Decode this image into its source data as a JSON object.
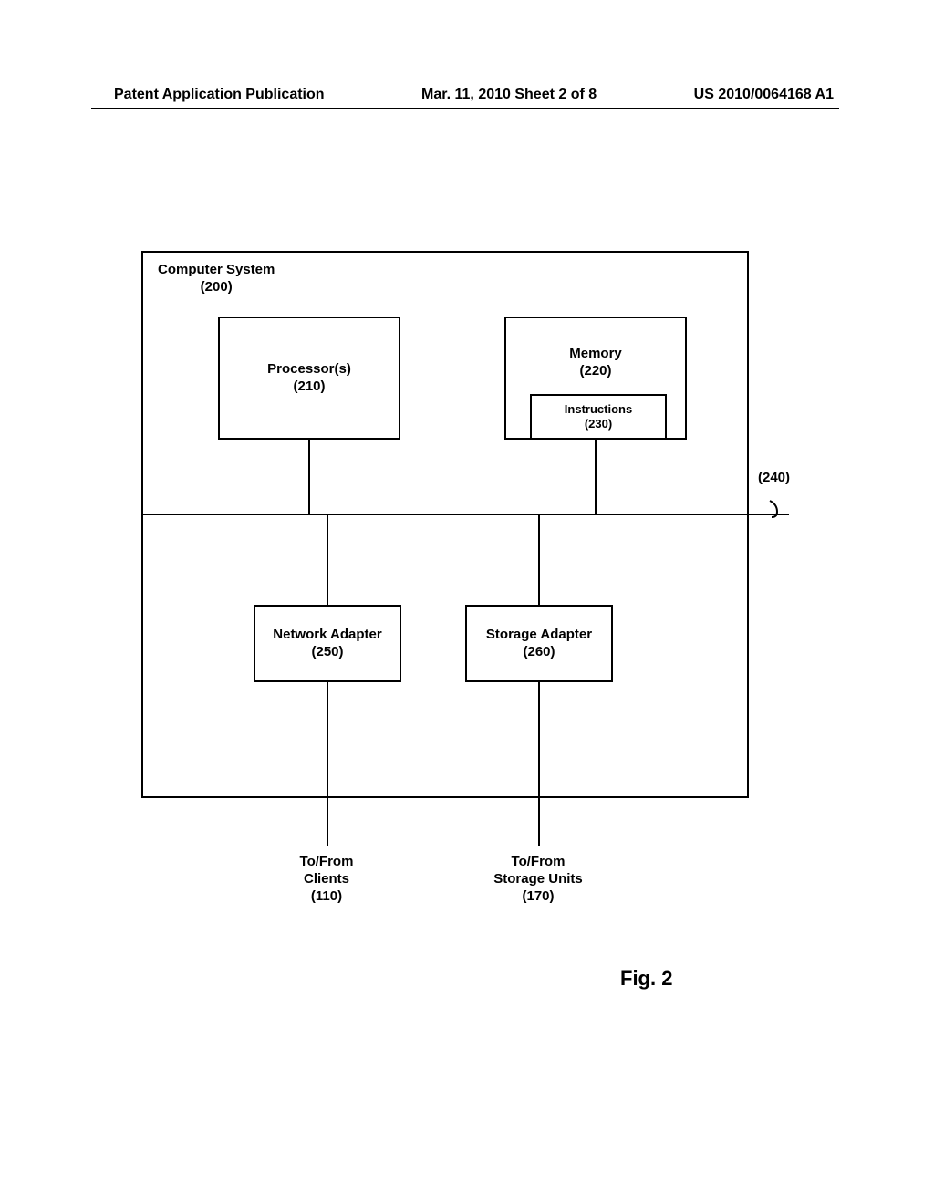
{
  "header": {
    "left": "Patent Application Publication",
    "middle": "Mar. 11, 2010  Sheet 2 of 8",
    "right": "US 2010/0064168 A1"
  },
  "system": {
    "label_line1": "Computer System",
    "label_line2": "(200)"
  },
  "processor": {
    "line1": "Processor(s)",
    "line2": "(210)"
  },
  "memory": {
    "line1": "Memory",
    "line2": "(220)"
  },
  "instructions": {
    "line1": "Instructions",
    "line2": "(230)"
  },
  "bus": {
    "label": "(240)"
  },
  "net_adapter": {
    "line1": "Network Adapter",
    "line2": "(250)"
  },
  "storage_adapter": {
    "line1": "Storage Adapter",
    "line2": "(260)"
  },
  "clients": {
    "line1": "To/From",
    "line2": "Clients",
    "line3": "(110)"
  },
  "storage_units": {
    "line1": "To/From",
    "line2": "Storage Units",
    "line3": "(170)"
  },
  "figure": {
    "label": "Fig. 2"
  }
}
